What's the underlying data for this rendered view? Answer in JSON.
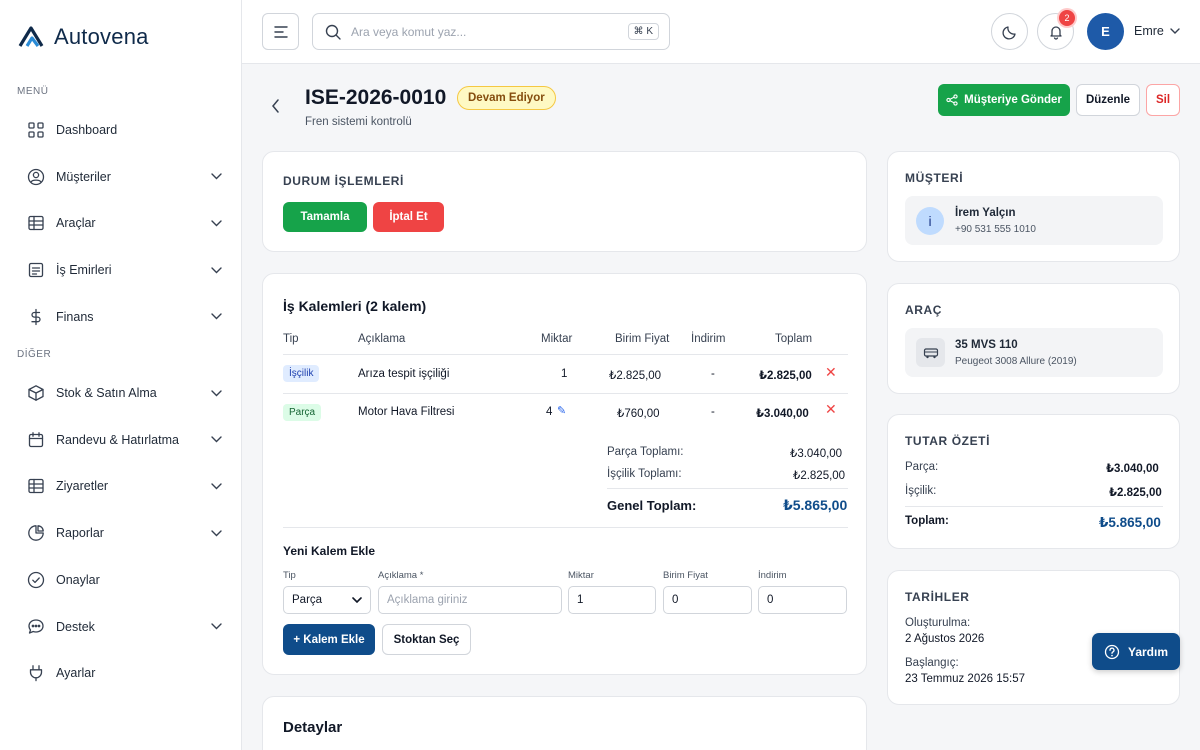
{
  "app": {
    "name": "Autovena"
  },
  "sidebar": {
    "menu_label": "MENÜ",
    "other_label": "DİĞER",
    "menu_items": [
      {
        "label": "Dashboard",
        "icon": "grid-icon",
        "chevron": false
      },
      {
        "label": "Müşteriler",
        "icon": "user-icon",
        "chevron": true
      },
      {
        "label": "Araçlar",
        "icon": "table-icon",
        "chevron": true
      },
      {
        "label": "İş Emirleri",
        "icon": "document-icon",
        "chevron": true
      },
      {
        "label": "Finans",
        "icon": "dollar-icon",
        "chevron": true
      }
    ],
    "other_items": [
      {
        "label": "Stok & Satın Alma",
        "icon": "box-icon",
        "chevron": true
      },
      {
        "label": "Randevu & Hatırlatma",
        "icon": "calendar-icon",
        "chevron": true
      },
      {
        "label": "Ziyaretler",
        "icon": "table-icon",
        "chevron": true
      },
      {
        "label": "Raporlar",
        "icon": "pie-chart-icon",
        "chevron": true
      },
      {
        "label": "Onaylar",
        "icon": "check-circle-icon",
        "chevron": false
      },
      {
        "label": "Destek",
        "icon": "chat-icon",
        "chevron": true
      },
      {
        "label": "Ayarlar",
        "icon": "plug-icon",
        "chevron": false
      }
    ]
  },
  "topbar": {
    "search_placeholder": "Ara veya komut yaz...",
    "shortcut": "⌘ K",
    "notification_count": "2",
    "user_initial": "E",
    "user_name": "Emre"
  },
  "header": {
    "title": "ISE-2026-0010",
    "status": "Devam Ediyor",
    "subtitle": "Fren sistemi kontrolü",
    "send_button": "Müşteriye Gönder",
    "edit_button": "Düzenle",
    "delete_button": "Sil"
  },
  "status_actions": {
    "title": "DURUM İŞLEMLERİ",
    "complete": "Tamamla",
    "cancel": "İptal Et"
  },
  "items": {
    "title": "İş Kalemleri (2 kalem)",
    "columns": {
      "type": "Tip",
      "desc": "Açıklama",
      "qty": "Miktar",
      "unit": "Birim Fiyat",
      "discount": "İndirim",
      "total": "Toplam"
    },
    "rows": [
      {
        "type": "İşçilik",
        "desc": "Arıza tespit işçiliği",
        "qty": "1",
        "unit": "₺2.825,00",
        "discount": "-",
        "total": "₺2.825,00"
      },
      {
        "type": "Parça",
        "desc": "Motor Hava Filtresi",
        "qty": "4",
        "unit": "₺760,00",
        "discount": "-",
        "total": "₺3.040,00"
      }
    ],
    "summary": {
      "parts_label": "Parça Toplamı:",
      "parts_value": "₺3.040,00",
      "labor_label": "İşçilik Toplamı:",
      "labor_value": "₺2.825,00",
      "grand_label": "Genel Toplam:",
      "grand_value": "₺5.865,00"
    },
    "add_form": {
      "title": "Yeni Kalem Ekle",
      "type_label": "Tip",
      "type_value": "Parça",
      "desc_label": "Açıklama *",
      "desc_placeholder": "Açıklama giriniz",
      "qty_label": "Miktar",
      "qty_value": "1",
      "unit_label": "Birim Fiyat",
      "unit_value": "0",
      "discount_label": "İndirim",
      "discount_value": "0",
      "add_button": "+ Kalem Ekle",
      "stock_button": "Stoktan Seç"
    }
  },
  "details": {
    "title": "Detaylar"
  },
  "customer": {
    "title": "MÜŞTERİ",
    "initial": "i",
    "name": "İrem Yalçın",
    "phone": "+90 531 555 1010"
  },
  "vehicle": {
    "title": "ARAÇ",
    "plate": "35 MVS 110",
    "model": "Peugeot 3008 Allure (2019)"
  },
  "amount_summary": {
    "title": "TUTAR ÖZETİ",
    "parts_label": "Parça:",
    "parts_value": "₺3.040,00",
    "labor_label": "İşçilik:",
    "labor_value": "₺2.825,00",
    "total_label": "Toplam:",
    "total_value": "₺5.865,00"
  },
  "dates": {
    "title": "TARİHLER",
    "created_label": "Oluşturulma:",
    "created_value": "2 Ağustos 2026",
    "start_label": "Başlangıç:",
    "start_value": "23 Temmuz 2026 15:57"
  },
  "help": {
    "label": "Yardım"
  },
  "colors": {
    "primary": "#0f4c8a",
    "success": "#16a34a",
    "danger": "#ef4444",
    "status_bg": "#fef9c3"
  }
}
